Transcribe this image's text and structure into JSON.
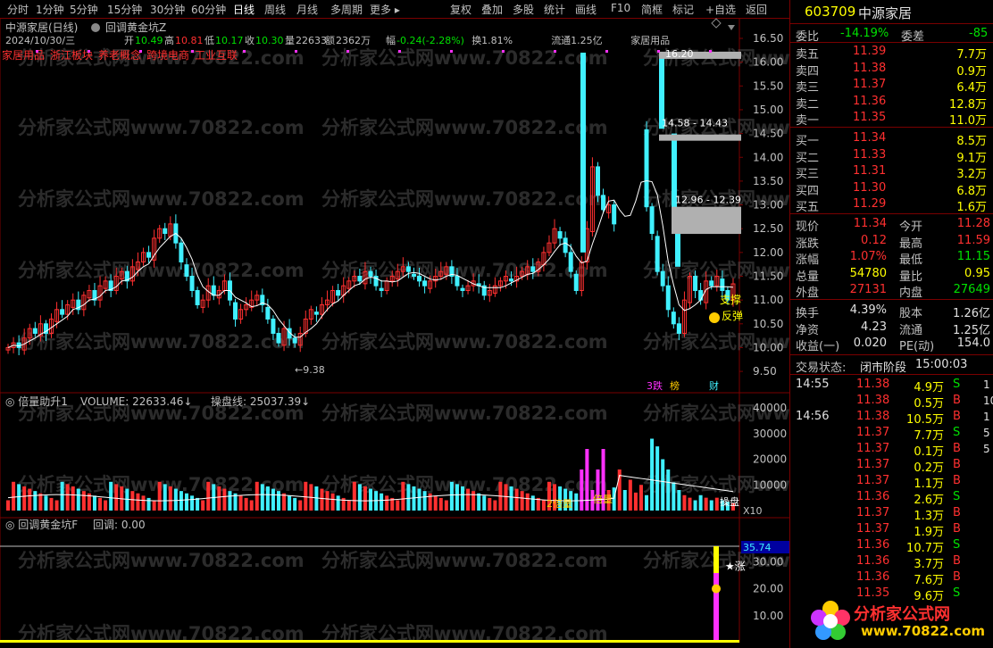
{
  "toolbar": {
    "items": [
      "分时",
      "1分钟",
      "5分钟",
      "15分钟",
      "30分钟",
      "60分钟",
      "日线",
      "周线",
      "月线",
      "多周期",
      "更多"
    ],
    "right_items": [
      "复权",
      "叠加",
      "多股",
      "统计",
      "画线",
      "F10",
      "简框",
      "标记",
      "+自选",
      "返回"
    ]
  },
  "main": {
    "title": "中源家居(日线)",
    "indicator": "回调黄金坑Z",
    "info_date": "2024/10/30/三",
    "info_open_label": "开",
    "info_open": "10.49",
    "info_high_label": "高",
    "info_high": "10.81",
    "info_low_label": "低",
    "info_low": "10.17",
    "info_close_label": "收",
    "info_close": "10.30",
    "info_vol_label": "量",
    "info_vol": "22633",
    "info_amt_label": "额",
    "info_amt": "2362万",
    "info_chg_label": "幅",
    "info_chg": "-0.24(-2.28%)",
    "info_turn": "换1.81%",
    "info_float": "流通1.25亿",
    "info_sector": "家居用品",
    "tags": [
      "家居用品",
      "浙江板块",
      "养老概念",
      "跨境电商",
      "工业互联"
    ],
    "annotations": [
      "16.20",
      "14.58 - 14.43",
      "12.96 - 12.39",
      "9.38",
      "支撑",
      "反弹",
      "3跌",
      "榜",
      "财"
    ],
    "price_axis": [
      "16.50",
      "16.00",
      "15.50",
      "15.00",
      "14.50",
      "14.00",
      "13.50",
      "13.00",
      "12.50",
      "12.00",
      "11.50",
      "11.00",
      "10.50",
      "10.00",
      "9.50"
    ]
  },
  "volume_panel": {
    "title": "倍量助升1",
    "vol_label": "VOLUME: 22633.46",
    "line_label": "操盘线: 25037.39",
    "axis": [
      "40000",
      "30000",
      "20000",
      "10000"
    ],
    "unit": "X10",
    "marks": [
      "2倍量",
      "倍量",
      "操盘"
    ]
  },
  "indicator_panel": {
    "title": "回调黄金坑F",
    "value_label": "回调: 0.00",
    "axis": [
      "35.74",
      "30.00",
      "20.00",
      "10.00"
    ],
    "mark": "涨"
  },
  "quote": {
    "code": "603709",
    "name": "中源家居",
    "weibi_label": "委比",
    "weibi": "-14.19%",
    "weicha_label": "委差",
    "weicha": "-85",
    "asks": [
      {
        "label": "卖五",
        "price": "11.39",
        "vol": "7.7万"
      },
      {
        "label": "卖四",
        "price": "11.38",
        "vol": "0.9万"
      },
      {
        "label": "卖三",
        "price": "11.37",
        "vol": "6.4万"
      },
      {
        "label": "卖二",
        "price": "11.36",
        "vol": "12.8万"
      },
      {
        "label": "卖一",
        "price": "11.35",
        "vol": "11.0万"
      }
    ],
    "bids": [
      {
        "label": "买一",
        "price": "11.34",
        "vol": "8.5万"
      },
      {
        "label": "买二",
        "price": "11.33",
        "vol": "9.1万"
      },
      {
        "label": "买三",
        "price": "11.31",
        "vol": "3.2万"
      },
      {
        "label": "买四",
        "price": "11.30",
        "vol": "6.8万"
      },
      {
        "label": "买五",
        "price": "11.29",
        "vol": "1.6万"
      }
    ],
    "stats": [
      {
        "l1": "现价",
        "v1": "11.34",
        "l2": "今开",
        "v2": "11.28"
      },
      {
        "l1": "涨跌",
        "v1": "0.12",
        "l2": "最高",
        "v2": "11.59"
      },
      {
        "l1": "涨幅",
        "v1": "1.07%",
        "l2": "最低",
        "v2": "11.15"
      },
      {
        "l1": "总量",
        "v1": "54780",
        "l2": "量比",
        "v2": "0.95"
      },
      {
        "l1": "外盘",
        "v1": "27131",
        "l2": "内盘",
        "v2": "27649"
      }
    ],
    "stats2": [
      {
        "l1": "换手",
        "v1": "4.39%",
        "l2": "股本",
        "v2": "1.26亿"
      },
      {
        "l1": "净资",
        "v1": "4.23",
        "l2": "流通",
        "v2": "1.25亿"
      },
      {
        "l1": "收益(一)",
        "v1": "0.020",
        "l2": "PE(动)",
        "v2": "154.0"
      }
    ],
    "status_label": "交易状态:",
    "status": "闭市阶段",
    "status_time": "15:00:03",
    "trades": [
      {
        "t": "14:55",
        "p": "11.38",
        "v": "4.9万",
        "s": "S"
      },
      {
        "t": "",
        "p": "11.38",
        "v": "0.5万",
        "s": "B"
      },
      {
        "t": "14:56",
        "p": "11.38",
        "v": "10.5万",
        "s": "B"
      },
      {
        "t": "",
        "p": "11.37",
        "v": "7.7万",
        "s": "S"
      },
      {
        "t": "",
        "p": "11.37",
        "v": "0.1万",
        "s": "B"
      },
      {
        "t": "",
        "p": "11.37",
        "v": "0.2万",
        "s": "B"
      },
      {
        "t": "",
        "p": "11.37",
        "v": "1.1万",
        "s": "B"
      },
      {
        "t": "",
        "p": "11.36",
        "v": "2.6万",
        "s": "S"
      },
      {
        "t": "",
        "p": "11.37",
        "v": "1.3万",
        "s": "B"
      },
      {
        "t": "",
        "p": "11.37",
        "v": "1.9万",
        "s": "B"
      },
      {
        "t": "",
        "p": "11.36",
        "v": "10.7万",
        "s": "S"
      },
      {
        "t": "",
        "p": "11.36",
        "v": "3.7万",
        "s": "B"
      },
      {
        "t": "",
        "p": "11.36",
        "v": "7.6万",
        "s": "B"
      },
      {
        "t": "",
        "p": "11.35",
        "v": "9.6万",
        "s": "S"
      }
    ],
    "trade_extra": [
      "1",
      "10",
      "1",
      "5",
      "5"
    ]
  },
  "watermark": "分析家公式网www.70822.com",
  "logo": {
    "text": "分析家公式网",
    "url": "www.70822.com"
  },
  "colors": {
    "up": "#ff3030",
    "down": "#40f0ff",
    "ma": "#ffffff",
    "magenta": "#ff30ff",
    "yellow": "#ffff00",
    "grid": "#7a0000"
  }
}
